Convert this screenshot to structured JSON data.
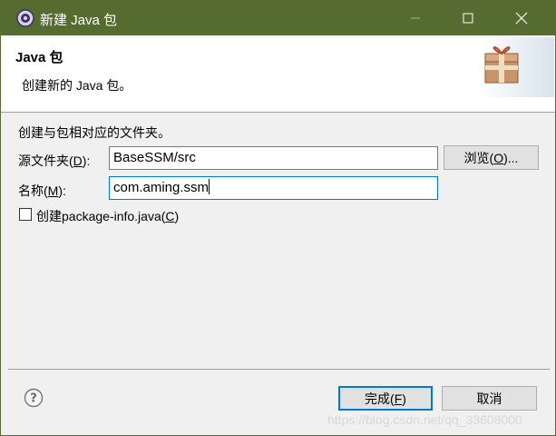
{
  "window": {
    "title": "新建 Java 包",
    "icons": {
      "app": "eclipse-gear-icon",
      "minimize": "minimize-icon",
      "maximize": "maximize-icon",
      "close": "close-icon"
    }
  },
  "header": {
    "title": "Java 包",
    "description": "创建新的 Java 包。",
    "image_icon": "package-gift-icon"
  },
  "form": {
    "intro": "创建与包相对应的文件夹。",
    "source_folder": {
      "label": "源文件夹(",
      "mnemonic": "D",
      "label_end": "):",
      "value": "BaseSSM/src"
    },
    "browse_button": {
      "label": "浏览(",
      "mnemonic": "O",
      "label_end": ")..."
    },
    "name": {
      "label": "名称(",
      "mnemonic": "M",
      "label_end": "):",
      "value": "com.aming.ssm"
    },
    "package_info": {
      "label": "创建package-info.java(",
      "mnemonic": "C",
      "label_end": ")",
      "checked": false
    }
  },
  "footer": {
    "help_icon": "help-icon",
    "finish_button": {
      "label": "完成(",
      "mnemonic": "F",
      "label_end": ")"
    },
    "cancel_button": {
      "label": "取消"
    }
  },
  "watermark": "https://blog.csdn.net/qq_33608000",
  "colors": {
    "titlebar": "#556b2f",
    "accent": "#0078d7",
    "dialog_bg": "#f0f0f0"
  }
}
